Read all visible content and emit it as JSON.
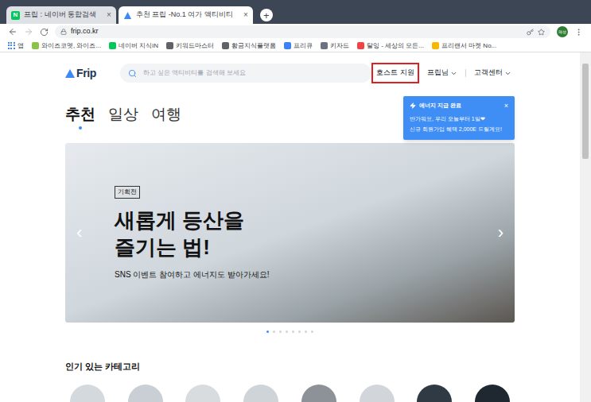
{
  "browser": {
    "tabs": [
      {
        "label": "프립 : 네이버 통합검색",
        "selected": false,
        "close": "×",
        "favicon": {
          "kind": "letter",
          "text": "N",
          "color": "#03c75a"
        }
      },
      {
        "label": "추천 프립 -No.1 여가 액티비티",
        "selected": true,
        "close": "×",
        "favicon": {
          "kind": "triangle",
          "color": "#3d8af7"
        }
      }
    ],
    "new_tab": "+",
    "url": "frip.co.kr",
    "profile": "해성",
    "bookmarks": [
      {
        "label": "앱",
        "kind": "apps",
        "color": "#4285f4"
      },
      {
        "label": "와이즈코멧, 와이즈...",
        "kind": "site",
        "color": "#8bc34a"
      },
      {
        "label": "네이버 지식iN",
        "kind": "site",
        "color": "#03c75a"
      },
      {
        "label": "키워드마스터",
        "kind": "site",
        "color": "#5f6368"
      },
      {
        "label": "황금지식플랫폼",
        "kind": "site",
        "color": "#5f6368"
      },
      {
        "label": "프리큐",
        "kind": "site",
        "color": "#3b82f6"
      },
      {
        "label": "키자드",
        "kind": "site",
        "color": "#6b7280"
      },
      {
        "label": "탈잉 - 세상의 모든...",
        "kind": "site",
        "color": "#ef4444"
      },
      {
        "label": "프리랜서 마켓 No...",
        "kind": "site",
        "color": "#f5b700"
      }
    ]
  },
  "page": {
    "logo": "Frip",
    "search": {
      "placeholder": "하고 싶은 액티비티를 검색해 보세요"
    },
    "nav": [
      {
        "label": "호스트 지원",
        "highlighted": true,
        "dropdown": false
      },
      {
        "label": "프립님",
        "highlighted": false,
        "dropdown": true
      },
      {
        "label": "고객센터",
        "highlighted": false,
        "dropdown": true
      }
    ],
    "tabs": [
      {
        "label": "추천",
        "selected": true
      },
      {
        "label": "일상",
        "selected": false
      },
      {
        "label": "여행",
        "selected": false
      }
    ],
    "toast": {
      "title": "에너지 지급 완료",
      "close": "×",
      "lines": [
        "반가워요, 우리 오늘부터 1일❤",
        "신규 회원가입 혜택 2,000E 드릴게요!"
      ]
    },
    "banner": {
      "tag": "기획전",
      "title": [
        "새롭게 등산을",
        "즐기는 법!"
      ],
      "subtitle": "SNS 이벤트 참여하고 에너지도 받아가세요!",
      "prev": "‹",
      "next": "›",
      "dots": [
        {
          "selected": true
        },
        {
          "selected": false
        },
        {
          "selected": false
        },
        {
          "selected": false
        },
        {
          "selected": false
        },
        {
          "selected": false
        },
        {
          "selected": false
        },
        {
          "selected": false
        }
      ]
    },
    "section_title": "인기 있는 카테고리",
    "categories": [
      {
        "color": "#d4d9de"
      },
      {
        "color": "#c9cfd4"
      },
      {
        "color": "#d8dcdf"
      },
      {
        "color": "#cfd4d8"
      },
      {
        "color": "#8c9298"
      },
      {
        "color": "#d2d6da"
      },
      {
        "color": "#2f3a44"
      },
      {
        "color": "#1f2730"
      }
    ]
  }
}
